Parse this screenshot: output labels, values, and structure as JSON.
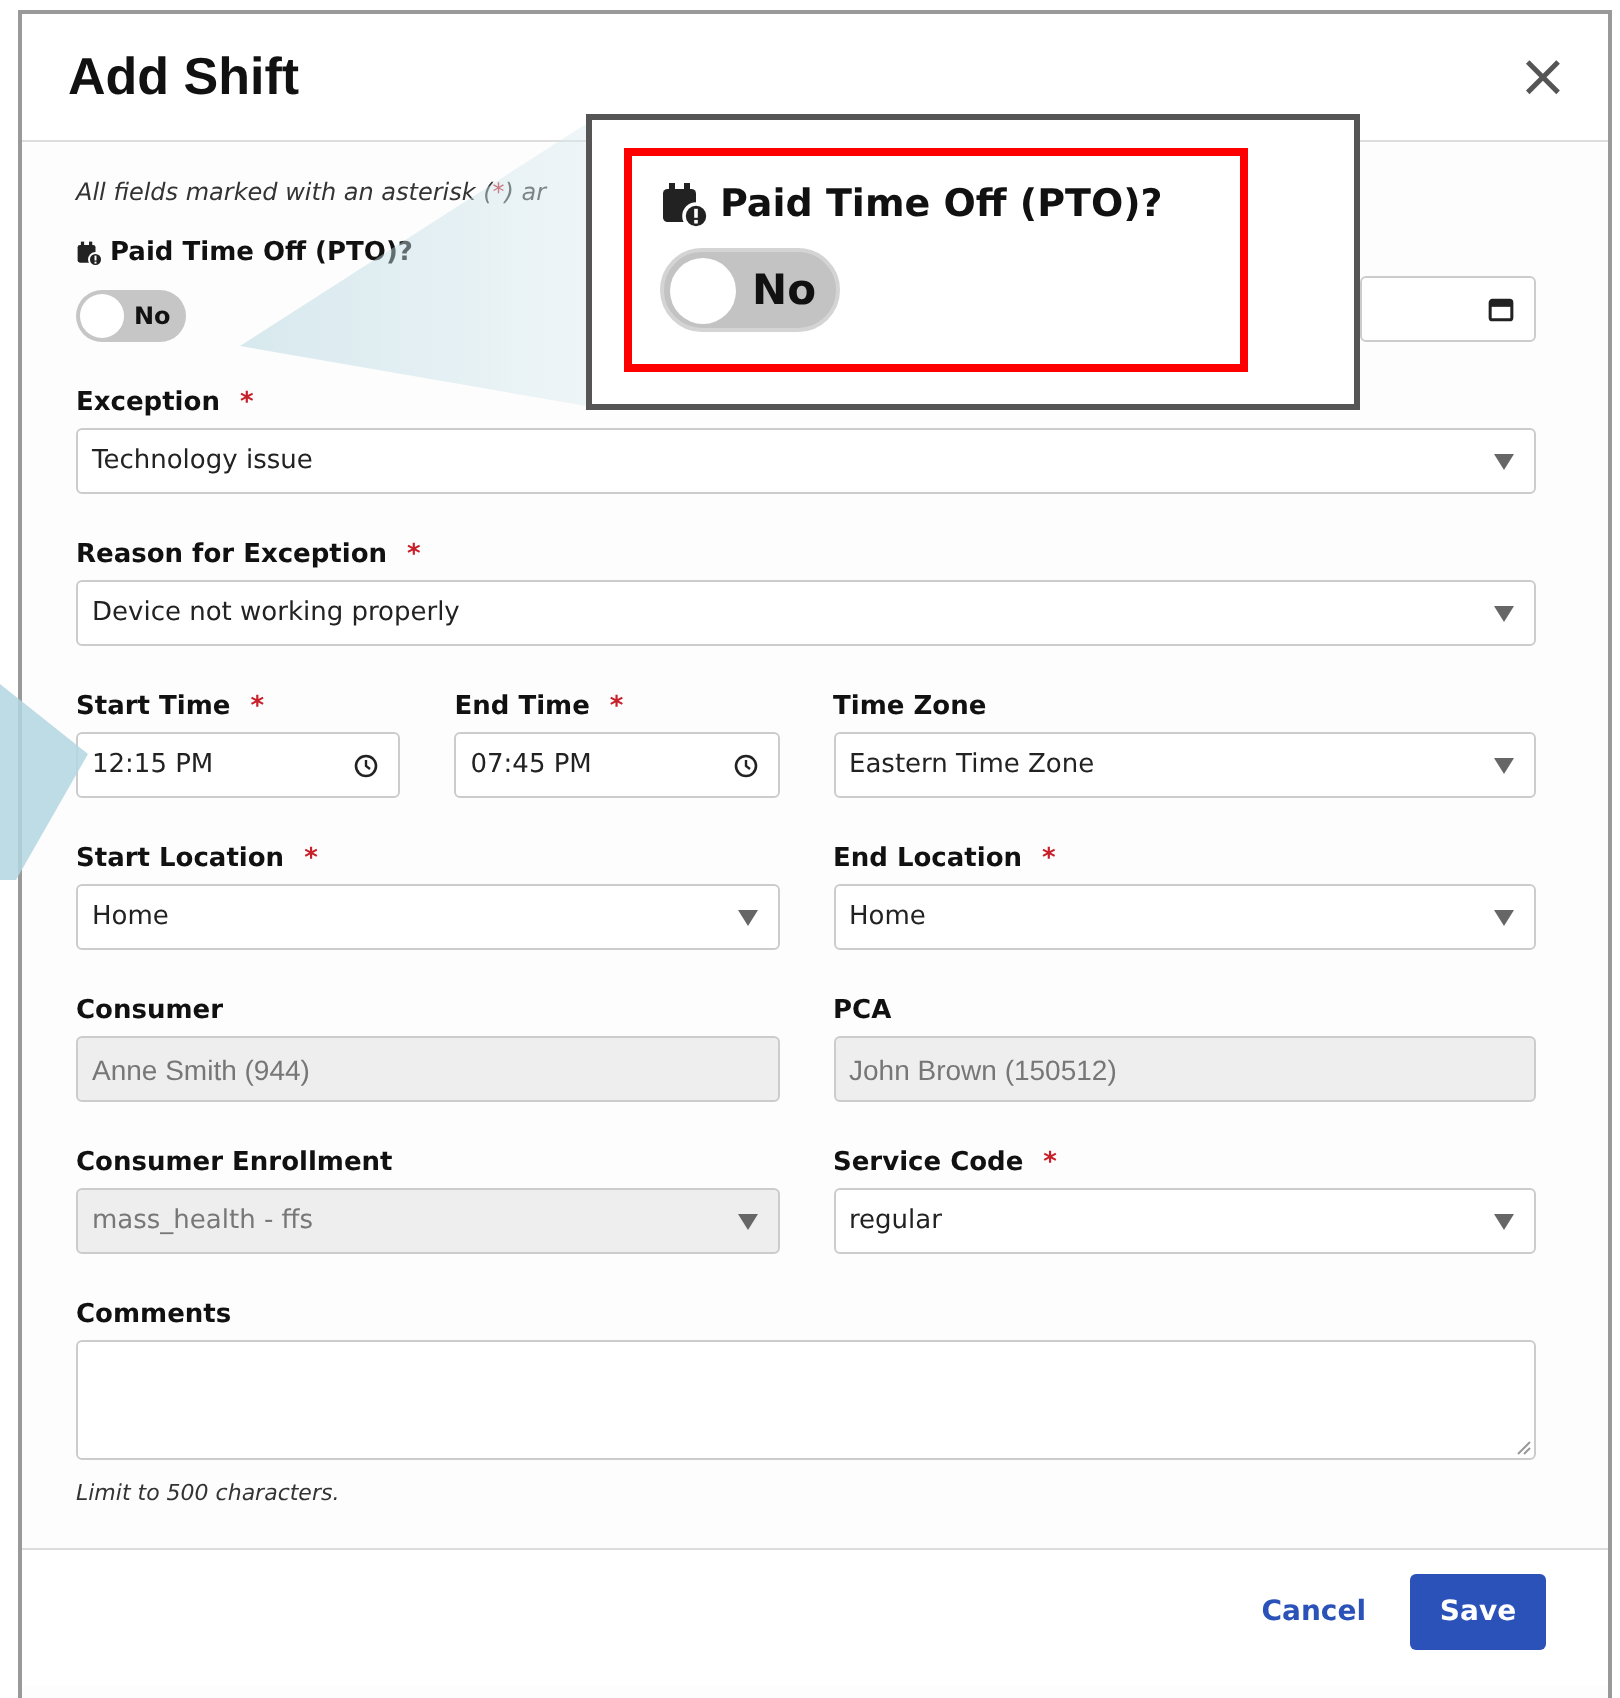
{
  "dialog": {
    "title": "Add Shift",
    "close": "×"
  },
  "intro": {
    "before": "All fields marked with an asterisk (",
    "mark": "*",
    "after": ") ar"
  },
  "rows": [
    {
      "fields": [
        {
          "kind": "toggle",
          "label": "Paid Time Off (PTO)?",
          "on": false,
          "text": "No"
        },
        {
          "kind": "date"
        }
      ]
    },
    {
      "fields": [
        {
          "kind": "select",
          "label": "Exception",
          "required": true,
          "value": "Technology issue",
          "disabled": false
        }
      ]
    },
    {
      "fields": [
        {
          "kind": "select",
          "label": "Reason for Exception",
          "required": true,
          "value": "Device not working properly",
          "disabled": false
        }
      ]
    },
    {
      "fields": [
        {
          "kind": "time",
          "label": "Start Time",
          "required": true,
          "value": "12:15 PM"
        },
        {
          "kind": "time",
          "label": "End Time",
          "required": true,
          "value": "07:45 PM"
        },
        {
          "kind": "select",
          "label": "Time Zone",
          "required": false,
          "value": "Eastern Time Zone",
          "disabled": false
        }
      ]
    },
    {
      "fields": [
        {
          "kind": "select",
          "label": "Start Location",
          "required": true,
          "value": "Home",
          "disabled": false
        },
        {
          "kind": "select",
          "label": "End Location",
          "required": true,
          "value": "Home",
          "disabled": false
        }
      ]
    },
    {
      "fields": [
        {
          "kind": "text",
          "label": "Consumer",
          "required": false,
          "value": "Anne Smith (944)",
          "disabled": true
        },
        {
          "kind": "text",
          "label": "PCA",
          "required": false,
          "value": "John Brown (150512)",
          "disabled": true
        }
      ]
    },
    {
      "fields": [
        {
          "kind": "select",
          "label": "Consumer Enrollment",
          "required": false,
          "value": "mass_health - ffs",
          "disabled": true
        },
        {
          "kind": "select",
          "label": "Service Code",
          "required": true,
          "value": "regular",
          "disabled": false
        }
      ]
    },
    {
      "fields": [
        {
          "kind": "textarea",
          "label": "Comments",
          "required": false,
          "hint": "Limit to 500 characters."
        }
      ]
    }
  ],
  "footer": {
    "cancel": "Cancel",
    "save": "Save"
  },
  "callout": {
    "label": "Paid Time Off (PTO)?",
    "on": false,
    "text": "No"
  }
}
